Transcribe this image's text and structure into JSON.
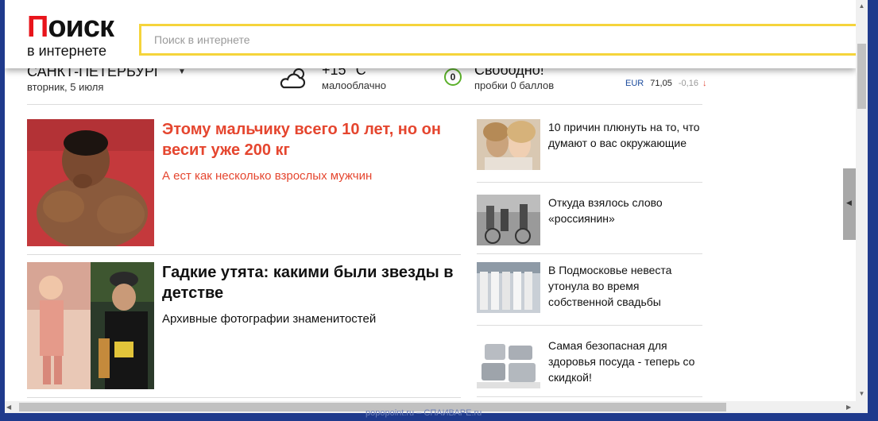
{
  "header": {
    "logo_first_letter": "П",
    "logo_rest": "оиск",
    "logo_subtitle": "в интернете",
    "search_placeholder": "Поиск в интернете"
  },
  "info": {
    "city": "САНКТ-ПЕТЕРБУРГ",
    "date": "вторник, 5 июля",
    "temperature": "+15 °C",
    "weather": "малооблачно",
    "traffic_score": "0",
    "traffic_status": "Свободно!",
    "traffic_desc": "пробки 0 баллов",
    "currency": {
      "name": "EUR",
      "value": "71,05",
      "change": "-0,16",
      "arrow": "↓"
    }
  },
  "main_articles": [
    {
      "title": "Этому мальчику всего 10 лет, но он весит уже 200 кг",
      "subtitle": "А ест как несколько взрослых мужчин",
      "color": "#e5462f"
    },
    {
      "title": "Гадкие утята: какими были звезды в детстве",
      "subtitle": "Архивные фотографии знаменитостей",
      "color": "#111111"
    }
  ],
  "side_articles": [
    {
      "title": "10 причин плюнуть на то, что думают о вас окружающие"
    },
    {
      "title": "Откуда взялось слово «россиянин»"
    },
    {
      "title": "В Подмосковье невеста утонула во время собственной свадьбы"
    },
    {
      "title": "Самая безопасная для здоровья посуда - теперь со скидкой!"
    }
  ],
  "watermark": "popopoint.ru – СПАИВАРЕ.ru"
}
